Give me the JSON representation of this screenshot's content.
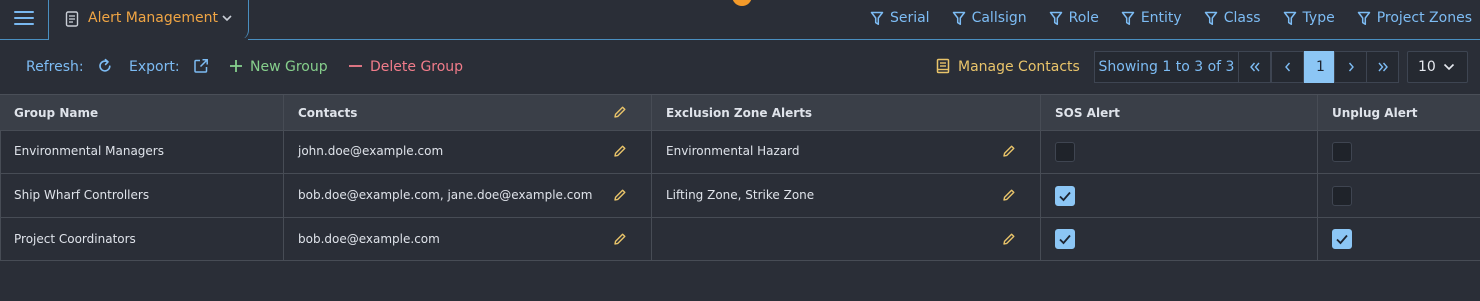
{
  "header": {
    "tab_title": "Alert Management",
    "filters": [
      "Serial",
      "Callsign",
      "Role",
      "Entity",
      "Class",
      "Type",
      "Project Zones"
    ]
  },
  "toolbar": {
    "refresh_label": "Refresh:",
    "export_label": "Export:",
    "new_group_label": "New Group",
    "delete_group_label": "Delete Group",
    "manage_contacts_label": "Manage Contacts"
  },
  "pager": {
    "info": "Showing 1 to 3 of 3",
    "current_page": "1",
    "page_size": "10"
  },
  "table": {
    "columns": [
      "Group Name",
      "Contacts",
      "Exclusion Zone Alerts",
      "SOS Alert",
      "Unplug Alert"
    ],
    "rows": [
      {
        "group": "Environmental Managers",
        "contacts": "john.doe@example.com",
        "zones": "Environmental Hazard",
        "sos": false,
        "unplug": false
      },
      {
        "group": "Ship Wharf Controllers",
        "contacts": "bob.doe@example.com, jane.doe@example.com",
        "zones": "Lifting Zone, Strike Zone",
        "sos": true,
        "unplug": false
      },
      {
        "group": "Project Coordinators",
        "contacts": "bob.doe@example.com",
        "zones": "",
        "sos": true,
        "unplug": true
      }
    ]
  },
  "colors": {
    "accent_blue": "#7dbcf4",
    "tab_orange": "#f0a544",
    "new_green": "#86cf8c",
    "delete_red": "#f17c8a",
    "edit_gold": "#e9c46a",
    "checked": "#8cc6f5"
  },
  "icons": {
    "menu": "hamburger-icon",
    "tab": "document-icon",
    "filter": "filter-icon",
    "refresh": "refresh-icon",
    "export": "external-link-icon",
    "new": "plus-icon",
    "delete": "minus-icon",
    "contacts": "book-icon",
    "edit": "pencil-icon",
    "check": "check-icon"
  }
}
